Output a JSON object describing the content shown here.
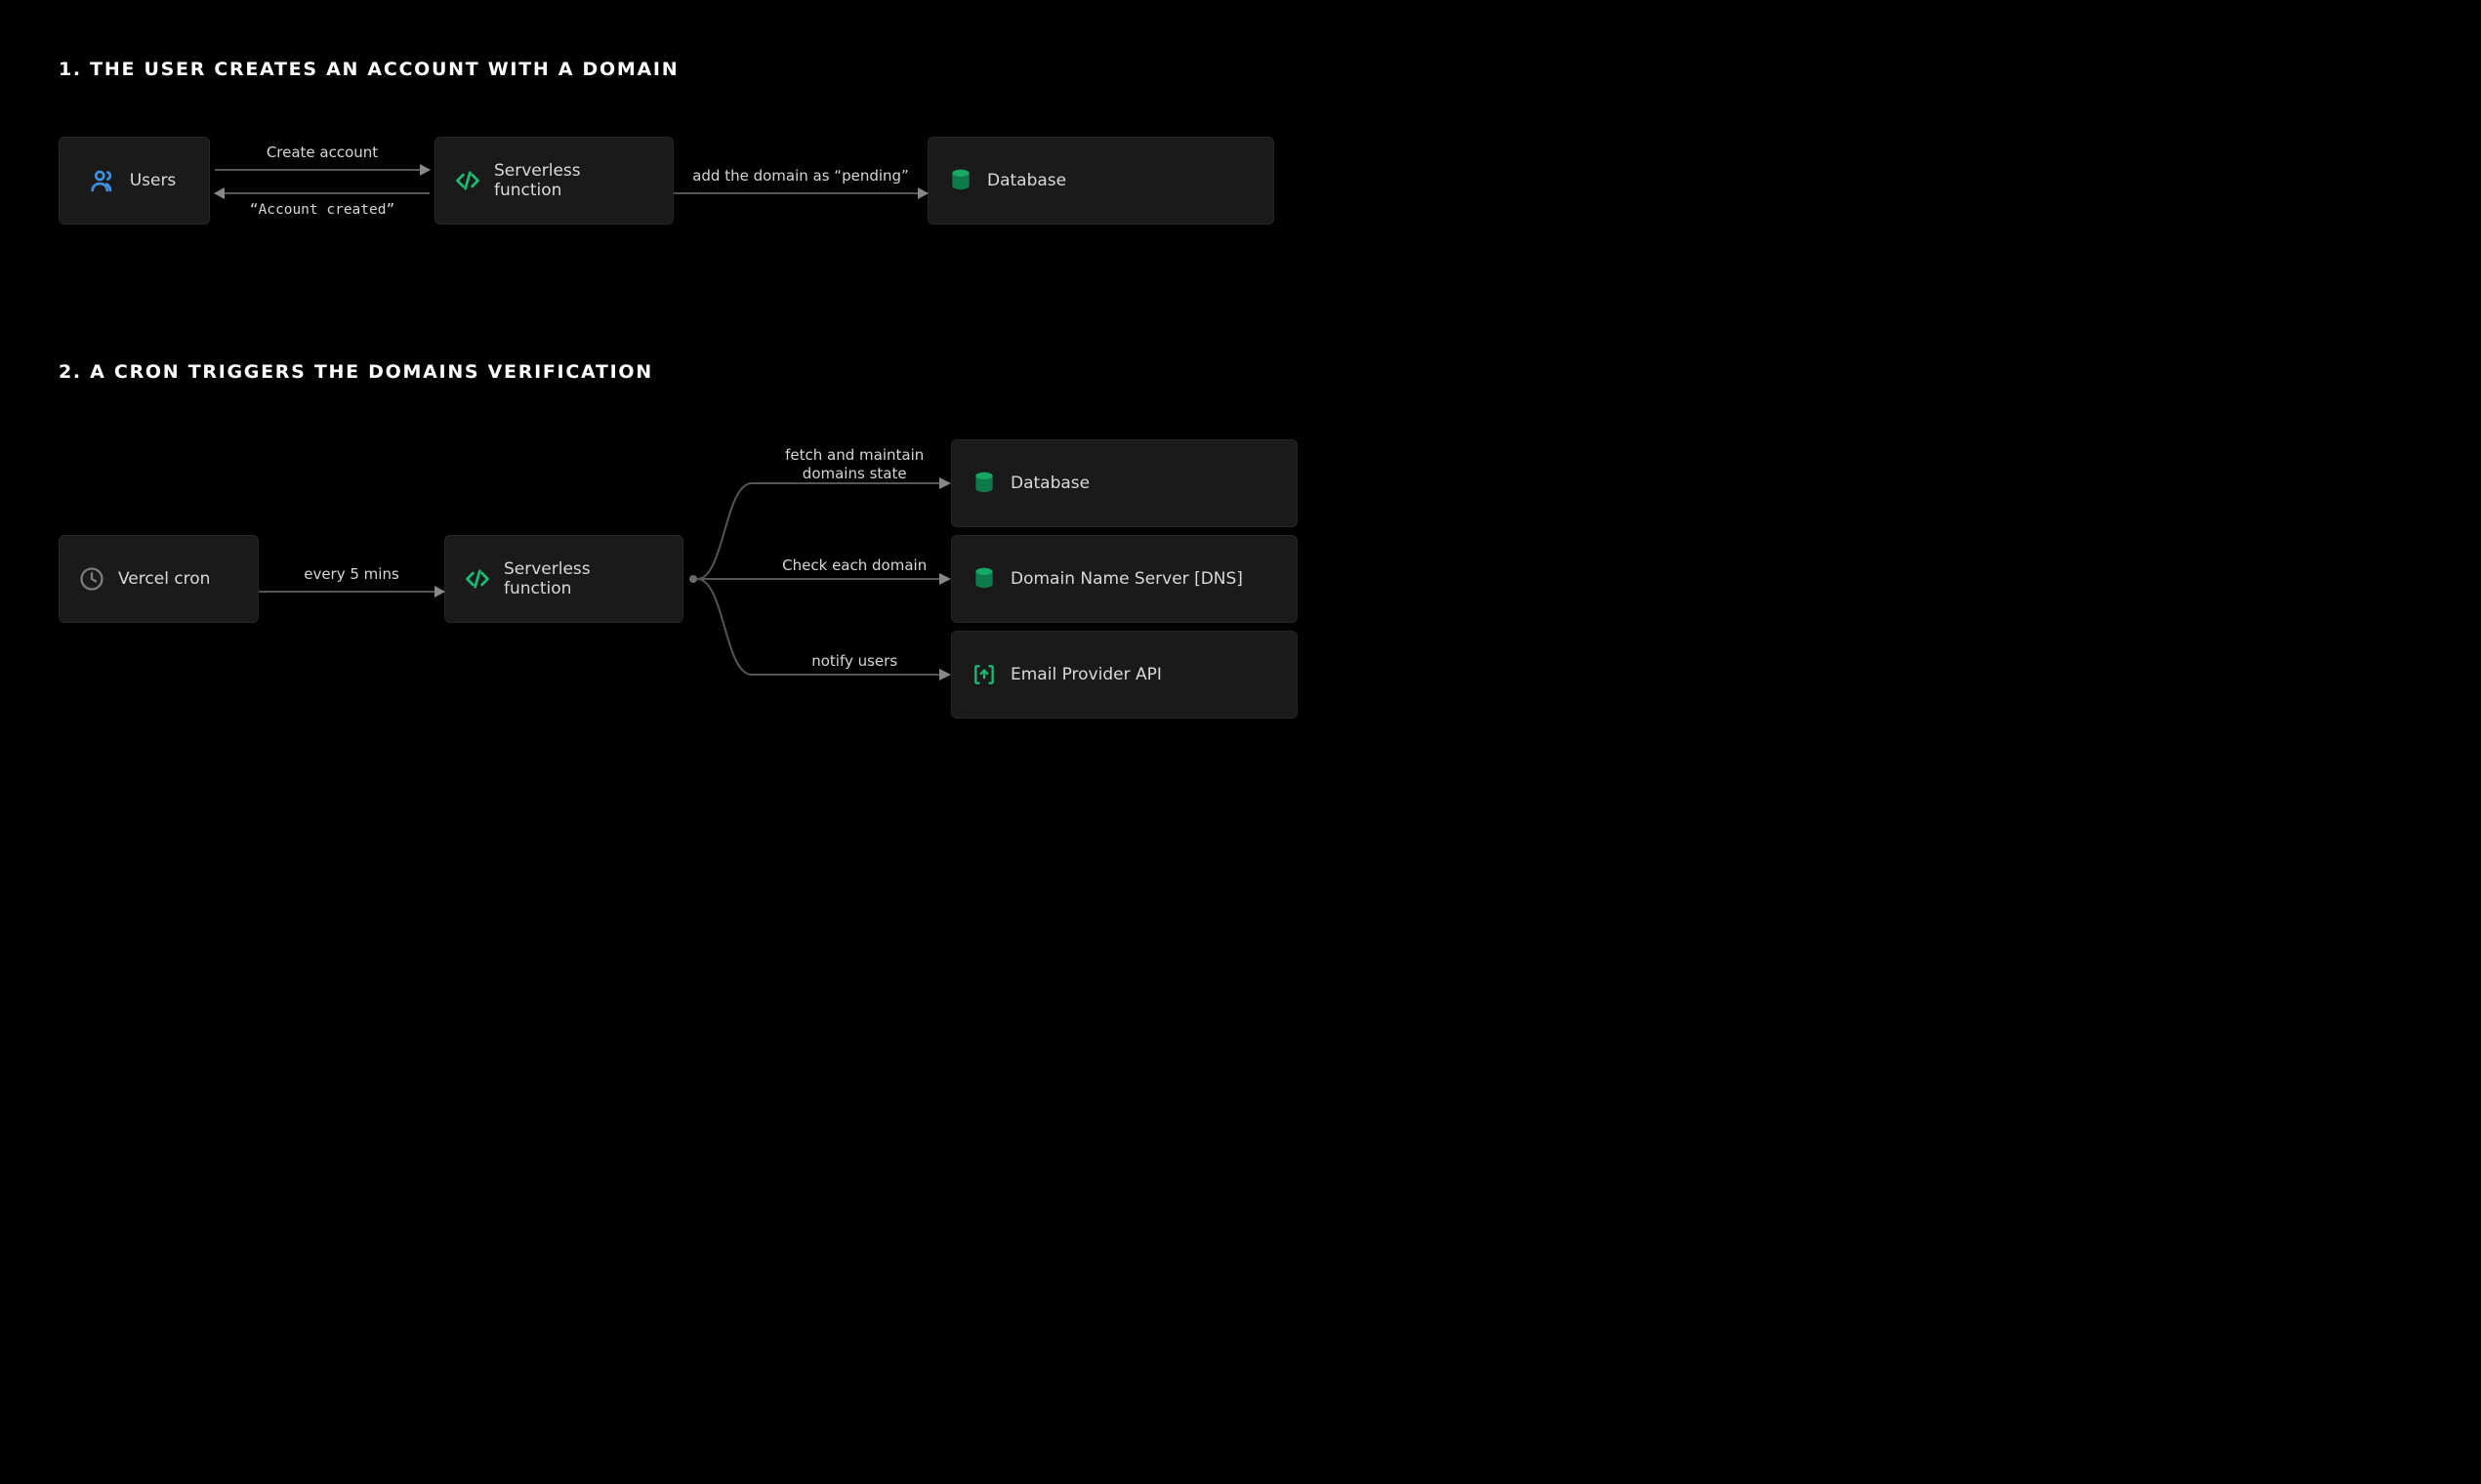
{
  "section1": {
    "title": "1. THE USER CREATES AN ACCOUNT WITH A DOMAIN",
    "nodes": {
      "users": "Users",
      "serverless": "Serverless function",
      "database": "Database"
    },
    "arrows": {
      "create_account": "Create account",
      "account_created": "“Account created”",
      "add_pending": "add the domain as “pending”"
    }
  },
  "section2": {
    "title": "2. A CRON TRIGGERS THE DOMAINS VERIFICATION",
    "nodes": {
      "cron": "Vercel cron",
      "serverless": "Serverless function",
      "database": "Database",
      "dns": "Domain Name Server  [DNS]",
      "email": "Email Provider API"
    },
    "arrows": {
      "every5": "every 5 mins",
      "fetch_maintain_l1": "fetch and maintain",
      "fetch_maintain_l2": "domains state",
      "check_domain": "Check each domain",
      "notify_users": "notify users"
    }
  },
  "icons": {
    "users": "users-icon",
    "code": "code-icon",
    "database": "database-icon",
    "clock": "clock-icon",
    "email_api": "bracket-upload-icon"
  },
  "colors": {
    "bg": "#000000",
    "node_bg": "#1a1a1a",
    "line": "#555555",
    "blue": "#3f8dde",
    "green": "#1db872"
  }
}
